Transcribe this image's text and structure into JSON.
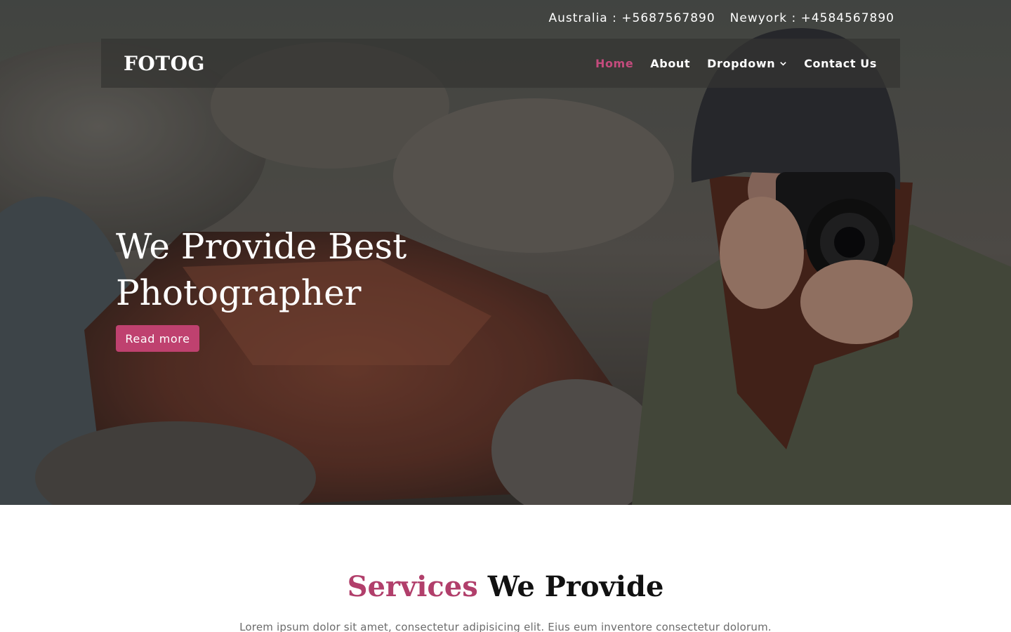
{
  "topbar": {
    "australia": "Australia : +5687567890",
    "newyork": "Newyork : +4584567890"
  },
  "navbar": {
    "brand": "FOTOG",
    "items": [
      {
        "label": "Home",
        "active": true
      },
      {
        "label": "About",
        "active": false
      },
      {
        "label": "Dropdown",
        "active": false,
        "has_dropdown": true
      },
      {
        "label": "Contact Us",
        "active": false
      }
    ]
  },
  "hero": {
    "title": "We Provide Best Photographer",
    "button": "Read more"
  },
  "services": {
    "title_accent": "Services",
    "title_rest": "We Provide",
    "text": "Lorem ipsum dolor sit amet, consectetur adipisicing elit. Eius eum inventore consectetur dolorum."
  },
  "colors": {
    "accent": "#c44b7d",
    "button": "#bf416f",
    "navbar_bg": "#343432"
  },
  "icons": {
    "dropdown": "chevron-down-icon"
  }
}
